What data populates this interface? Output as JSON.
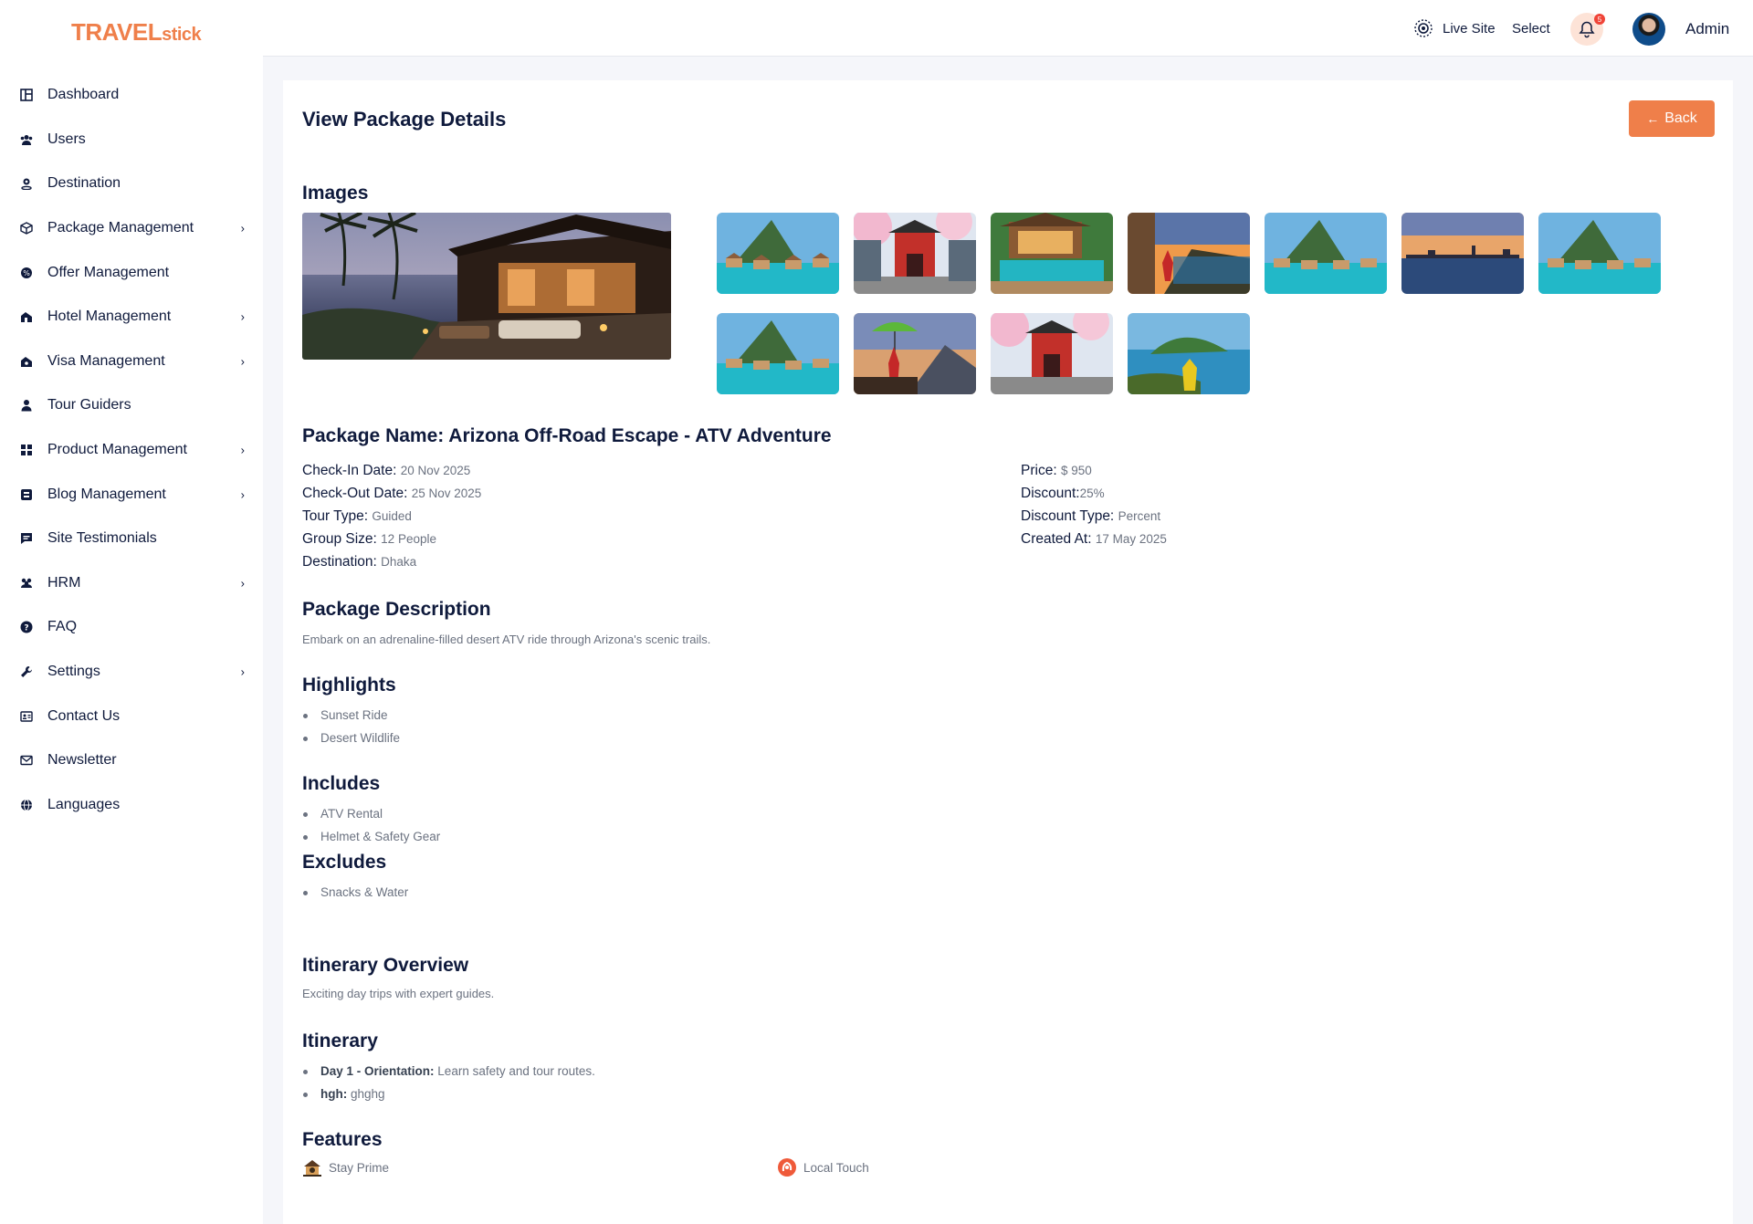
{
  "brand": {
    "logo_text": "TRAVEL",
    "logo_suffix": "stick",
    "accent": "#ef7f4a"
  },
  "sidebar": {
    "items": [
      {
        "label": "Dashboard",
        "icon": "dashboard-icon",
        "has_submenu": false
      },
      {
        "label": "Users",
        "icon": "users-icon",
        "has_submenu": false
      },
      {
        "label": "Destination",
        "icon": "map-pin-icon",
        "has_submenu": false
      },
      {
        "label": "Package Management",
        "icon": "box-icon",
        "has_submenu": true
      },
      {
        "label": "Offer Management",
        "icon": "offer-icon",
        "has_submenu": false
      },
      {
        "label": "Hotel Management",
        "icon": "hotel-icon",
        "has_submenu": true
      },
      {
        "label": "Visa Management",
        "icon": "visa-icon",
        "has_submenu": true
      },
      {
        "label": "Tour Guiders",
        "icon": "user-icon",
        "has_submenu": false
      },
      {
        "label": "Product Management",
        "icon": "grid-icon",
        "has_submenu": true
      },
      {
        "label": "Blog Management",
        "icon": "blog-icon",
        "has_submenu": true
      },
      {
        "label": "Site Testimonials",
        "icon": "chat-icon",
        "has_submenu": false
      },
      {
        "label": "HRM",
        "icon": "team-icon",
        "has_submenu": true
      },
      {
        "label": "FAQ",
        "icon": "question-icon",
        "has_submenu": false
      },
      {
        "label": "Settings",
        "icon": "wrench-icon",
        "has_submenu": true
      },
      {
        "label": "Contact Us",
        "icon": "contact-card-icon",
        "has_submenu": false
      },
      {
        "label": "Newsletter",
        "icon": "mail-icon",
        "has_submenu": false
      },
      {
        "label": "Languages",
        "icon": "globe-icon",
        "has_submenu": false
      }
    ]
  },
  "header": {
    "live_site": "Live Site",
    "select": "Select",
    "notification_count": "5",
    "admin": "Admin"
  },
  "page": {
    "title": "View Package Details",
    "back_label": "Back",
    "images_title": "Images",
    "package_name": "Package Name: Arizona Off-Road Escape - ATV Adventure",
    "details_left": [
      {
        "label": "Check-In Date:",
        "value": "20 Nov 2025"
      },
      {
        "label": "Check-Out Date:",
        "value": "25 Nov 2025"
      },
      {
        "label": "Tour Type:",
        "value": "Guided"
      },
      {
        "label": "Group Size:",
        "value": "12 People"
      },
      {
        "label": "Destination:",
        "value": "Dhaka"
      }
    ],
    "details_right": [
      {
        "label": "Price:",
        "value": "$ 950"
      },
      {
        "label": "Discount:",
        "value": "25%"
      },
      {
        "label": "Discount Type:",
        "value": "Percent"
      },
      {
        "label": "Created At:",
        "value": "17 May 2025"
      }
    ],
    "description_title": "Package Description",
    "description": "Embark on an adrenaline-filled desert ATV ride through Arizona's scenic trails.",
    "highlights_title": "Highlights",
    "highlights": [
      "Sunset Ride",
      "Desert Wildlife"
    ],
    "includes_title": "Includes",
    "includes": [
      "ATV Rental",
      "Helmet & Safety Gear"
    ],
    "excludes_title": "Excludes",
    "excludes": [
      "Snacks & Water"
    ],
    "itinerary_overview_title": "Itinerary Overview",
    "itinerary_overview": "Exciting day trips with expert guides.",
    "itinerary_title": "Itinerary",
    "itinerary": [
      {
        "day": "Day 1 - Orientation:",
        "text": "Learn safety and tour routes."
      },
      {
        "day": "hgh:",
        "text": "ghghg"
      }
    ],
    "features_title": "Features",
    "features": [
      {
        "label": "Stay Prime",
        "icon": "house-icon"
      },
      {
        "label": "Local Touch",
        "icon": "local-touch-icon"
      }
    ],
    "thumbnails": [
      "overwater-bungalows",
      "japan-pagoda-cherry-blossom",
      "resort-pool",
      "coastal-cliff-traveler",
      "overwater-bungalows",
      "city-skyline-dusk",
      "overwater-bungalows",
      "overwater-bungalows",
      "traveler-umbrella-mountains",
      "japan-pagoda-cherry-blossom",
      "island-viewpoint-traveler"
    ]
  }
}
